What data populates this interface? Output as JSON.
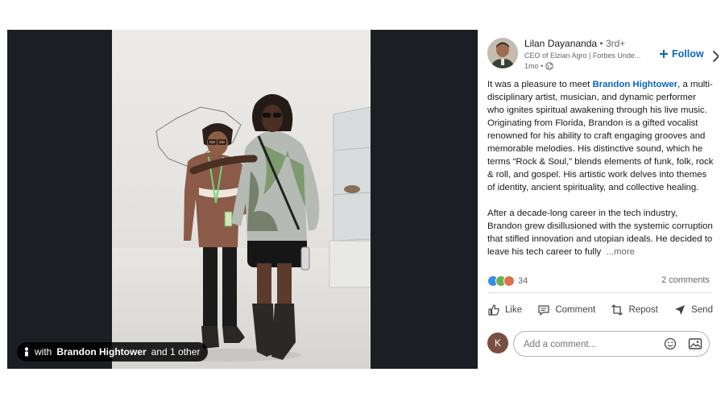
{
  "author": {
    "name": "Lilan Dayananda",
    "degree": "• 3rd+",
    "headline": "CEO of Elzian Agro | Forbes Unde...",
    "time": "1mo •"
  },
  "header": {
    "follow_label": "Follow",
    "follow_icon": "plus-icon",
    "close_icon": "close-icon"
  },
  "photo": {
    "tag_prefix": "with ",
    "tag_name": "Brandon Hightower",
    "tag_suffix": " and 1 other"
  },
  "post": {
    "p1_before": "It was a pleasure to meet ",
    "p1_mention": "Brandon Hightower",
    "p1_after": ", a multi-disciplinary artist, musician, and dynamic performer who ignites spiritual awakening through his live music. Originating from Florida, Brandon is a gifted vocalist renowned for his ability to craft engaging grooves and memorable melodies. His distinctive sound, which he terms “Rock & Soul,” blends elements of funk, folk, rock & roll, and gospel. His artistic work delves into themes of identity, ancient spirituality, and collective healing.",
    "p2": "After a decade-long career in the tech industry, Brandon grew disillusioned with the systemic corruption that stifled innovation and utopian ideals. He decided to leave his tech career to fully",
    "more": "...more"
  },
  "social": {
    "reaction_count": "34",
    "comments": "2 comments",
    "reaction_colors": [
      "#378fe9",
      "#6dae4f",
      "#df704d"
    ]
  },
  "actions": {
    "like": "Like",
    "comment": "Comment",
    "repost": "Repost",
    "send": "Send"
  },
  "composer": {
    "avatar_letter": "K",
    "placeholder": "Add a comment..."
  },
  "colors": {
    "brand_blue": "#0a66c2",
    "photo_background": "#1b1f23"
  }
}
